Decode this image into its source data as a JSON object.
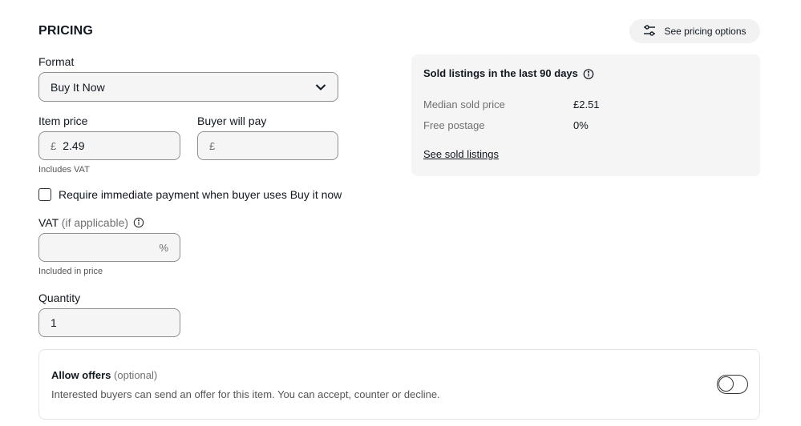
{
  "section": {
    "title": "PRICING"
  },
  "pricing_options": {
    "label": "See pricing options",
    "icon": "sliders-icon"
  },
  "format": {
    "label": "Format",
    "value": "Buy It Now",
    "icon": "chevron-down-icon"
  },
  "item_price": {
    "label": "Item price",
    "currency": "£",
    "value": "2.49",
    "helper": "Includes VAT"
  },
  "buyer_pays": {
    "label": "Buyer will pay",
    "currency": "£",
    "value": ""
  },
  "immediate_payment": {
    "label": "Require immediate payment when buyer uses Buy it now",
    "checked": false
  },
  "vat": {
    "label": "VAT",
    "label_suffix": "(if applicable)",
    "value": "",
    "unit": "%",
    "helper": "Included in price",
    "icon": "info-icon"
  },
  "quantity": {
    "label": "Quantity",
    "value": "1"
  },
  "sold_listings": {
    "title": "Sold listings in the last 90 days",
    "icon": "info-icon",
    "rows": [
      {
        "label": "Median sold price",
        "value": "£2.51"
      },
      {
        "label": "Free postage",
        "value": "0%"
      }
    ],
    "link": "See sold listings"
  },
  "offers": {
    "title": "Allow offers",
    "title_suffix": "(optional)",
    "description": "Interested buyers can send an offer for this item. You can accept, counter or decline.",
    "enabled": false
  }
}
